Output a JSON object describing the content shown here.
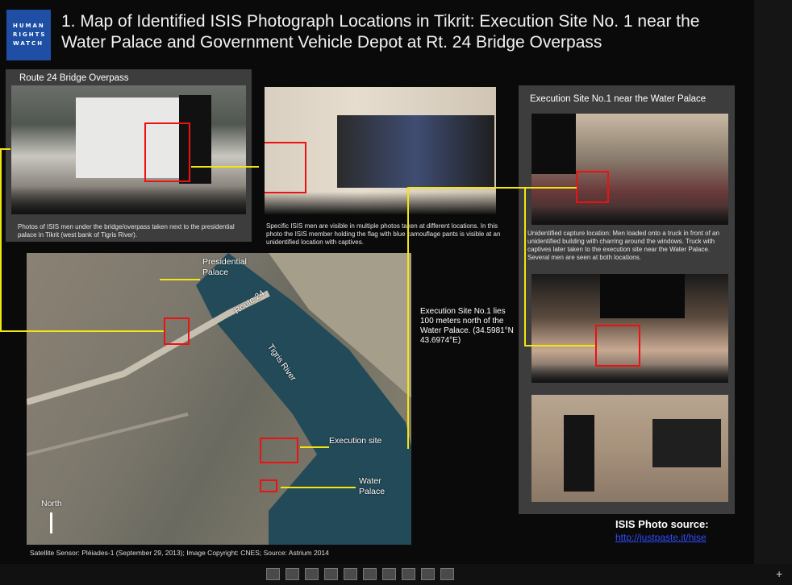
{
  "logo": {
    "line1": "HUMAN",
    "line2": "RIGHTS",
    "line3": "WATCH"
  },
  "title": "1. Map of Identified ISIS Photograph Locations in Tikrit: Execution Site No. 1 near the Water Palace and Government Vehicle Depot at Rt. 24 Bridge Overpass",
  "panel_left": {
    "header": "Route 24 Bridge Overpass",
    "caption": "Photos of ISIS men under the bridge/overpass taken next to the presidential palace in Tikrit (west bank of Tigris River)."
  },
  "middle_caption": "Specific ISIS men are visible in multiple photos taken at different locations. In this photo the ISIS member holding the flag with blue camouflage pants is visible at an unidentified location with captives.",
  "panel_right": {
    "header": "Execution Site No.1 near the Water Palace",
    "caption": "Unidentified capture location: Men loaded onto a truck in front of an unidentified building with charring around the windows. Truck with captives later taken to the execution site near the Water Palace. Several men are seen at both locations."
  },
  "map": {
    "presidential_palace": "Presidential Palace",
    "route": "Route 24",
    "river": "Tigris River",
    "execution_site": "Execution site",
    "water_palace": "Water Palace",
    "north": "North"
  },
  "site_note": "Execution Site No.1 lies 100 meters north of the Water Palace. (34.5981°N  43.6974°E)",
  "source_label": "ISIS Photo source:",
  "source_link": "http://justpaste.it/hise",
  "satellite_credit": "Satellite Sensor: Pléiades-1 (September 29, 2013); Image Copyright: CNES; Source: Astrium 2014",
  "colors": {
    "accent": "#f2e512",
    "highlight": "#e11111",
    "logo_blue": "#1e4fa5",
    "link": "#2f4cff"
  }
}
